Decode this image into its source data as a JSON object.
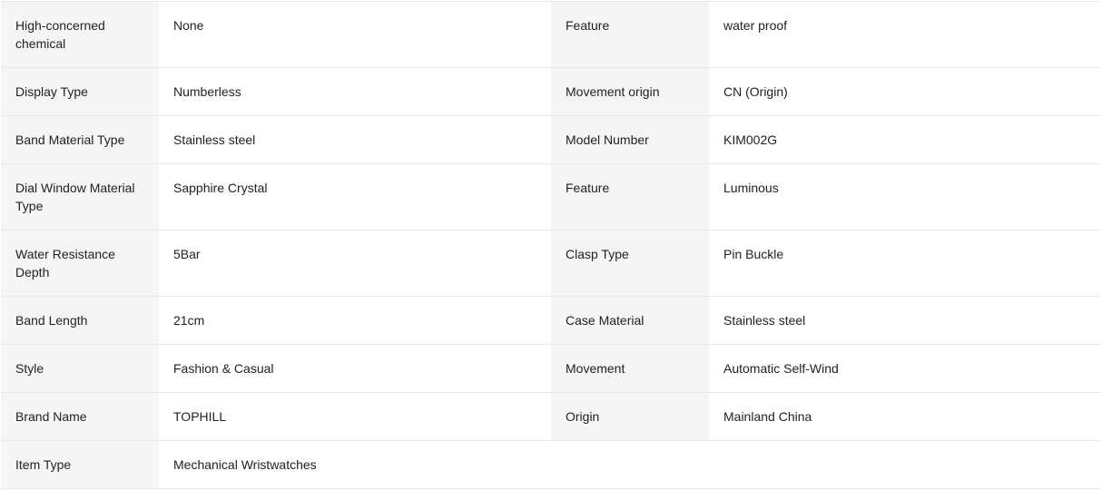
{
  "specs": [
    {
      "k1": "High-concerned chemical",
      "v1": "None",
      "k2": "Feature",
      "v2": "water proof"
    },
    {
      "k1": "Display Type",
      "v1": "Numberless",
      "k2": "Movement origin",
      "v2": "CN (Origin)"
    },
    {
      "k1": "Band Material Type",
      "v1": "Stainless steel",
      "k2": "Model Number",
      "v2": "KIM002G"
    },
    {
      "k1": "Dial Window Material Type",
      "v1": "Sapphire Crystal",
      "k2": "Feature",
      "v2": "Luminous"
    },
    {
      "k1": "Water Resistance Depth",
      "v1": "5Bar",
      "k2": "Clasp Type",
      "v2": "Pin Buckle"
    },
    {
      "k1": "Band Length",
      "v1": "21cm",
      "k2": "Case Material",
      "v2": "Stainless steel"
    },
    {
      "k1": "Style",
      "v1": "Fashion & Casual",
      "k2": "Movement",
      "v2": "Automatic Self-Wind"
    },
    {
      "k1": "Brand Name",
      "v1": "TOPHILL",
      "k2": "Origin",
      "v2": "Mainland China"
    },
    {
      "k1": "Item Type",
      "v1": "Mechanical Wristwatches",
      "k2": "",
      "v2": ""
    }
  ],
  "colors": {
    "key_background": "#f5f5f5",
    "value_background": "#ffffff",
    "border": "#e8e8e8",
    "text": "#222222"
  }
}
